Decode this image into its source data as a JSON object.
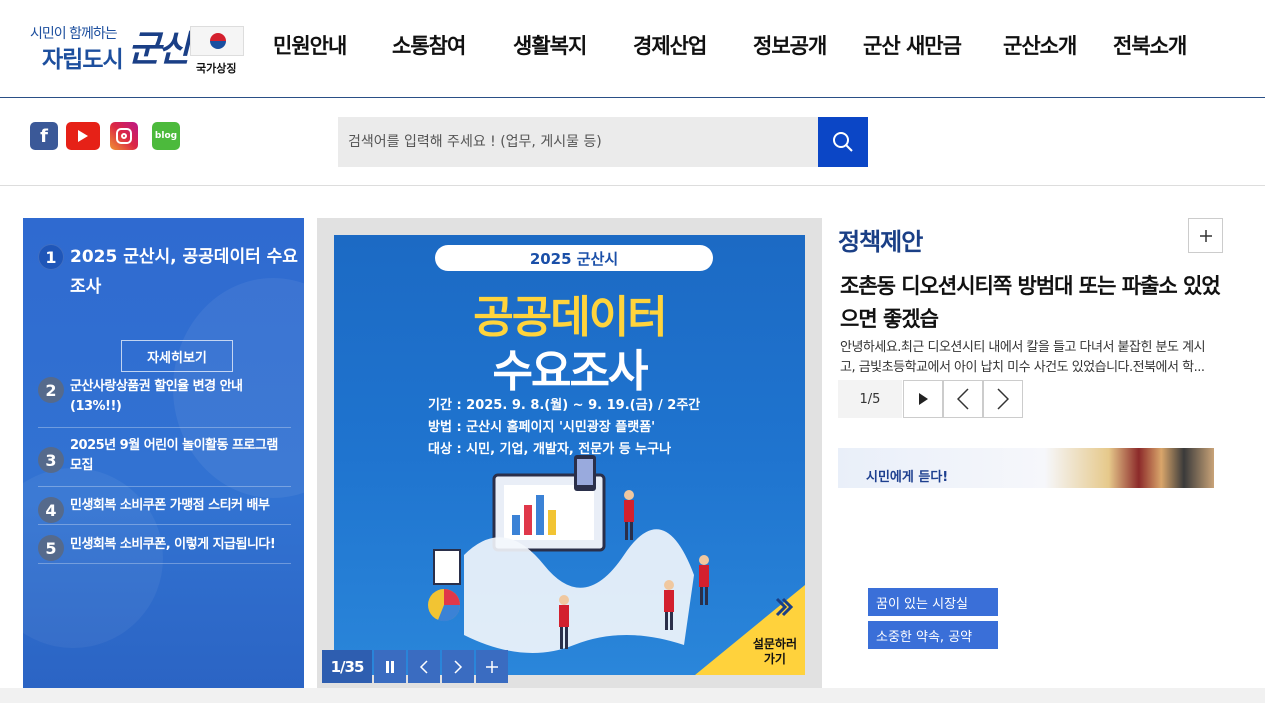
{
  "logo": {
    "slogan": "시민이 함께하는",
    "title": "자립도시",
    "brand": "군산",
    "symbol": "국가상징"
  },
  "nav": [
    "민원안내",
    "소통참여",
    "생활복지",
    "경제산업",
    "정보공개",
    "군산 새만금",
    "군산소개",
    "전북소개"
  ],
  "sns": {
    "facebook": "f",
    "blog": "blog"
  },
  "search": {
    "placeholder": "검색어를 입력해 주세요 ! (업무, 게시물 등)"
  },
  "news": {
    "first": {
      "num": "1",
      "title": "2025 군산시, 공공데이터 수요조사",
      "more": "자세히보기"
    },
    "items": [
      {
        "num": "2",
        "title": "군산사랑상품권 할인율 변경 안내 (13%!!)"
      },
      {
        "num": "3",
        "title": "2025년 9월 어린이 놀이활동 프로그램 모집"
      },
      {
        "num": "4",
        "title": "민생회복 소비쿠폰 가맹점 스티커 배부"
      },
      {
        "num": "5",
        "title": "민생회복 소비쿠폰, 이렇게 지급됩니다!"
      }
    ]
  },
  "banner": {
    "tag": "2025 군산시",
    "headline1": "공공데이터",
    "headline2": "수요조사",
    "info": [
      "기간 : 2025. 9. 8.(월) ~ 9. 19.(금) / 2주간",
      "방법 : 군산시 홈페이지 '시민광장 플랫폼'",
      "대상 : 시민, 기업, 개발자, 전문가 등 누구나"
    ],
    "corner_line1": "설문하러",
    "corner_line2": "가기",
    "counter": "1/35"
  },
  "policy": {
    "title": "정책제안",
    "headline": "조촌동 디오션시티쪽 방범대 또는 파출소 있었으면 좋겠습",
    "body": "안녕하세요.최근 디오션시티 내에서 칼을 들고 다녀서 붙잡힌 분도 계시고, 금빛초등학교에서 아이 납치 미수 사건도 있었습니다.전북에서 학...",
    "counter": "1/5"
  },
  "mayor": {
    "strip_label": "시민에게 듣다!",
    "buttons": [
      "꿈이 있는 시장실",
      "소중한 약속, 공약"
    ]
  },
  "colors": {
    "primary": "#1a3f86",
    "accent": "#0b46c6",
    "panel": "#2f6ad0",
    "highlight": "#ffd43c"
  }
}
